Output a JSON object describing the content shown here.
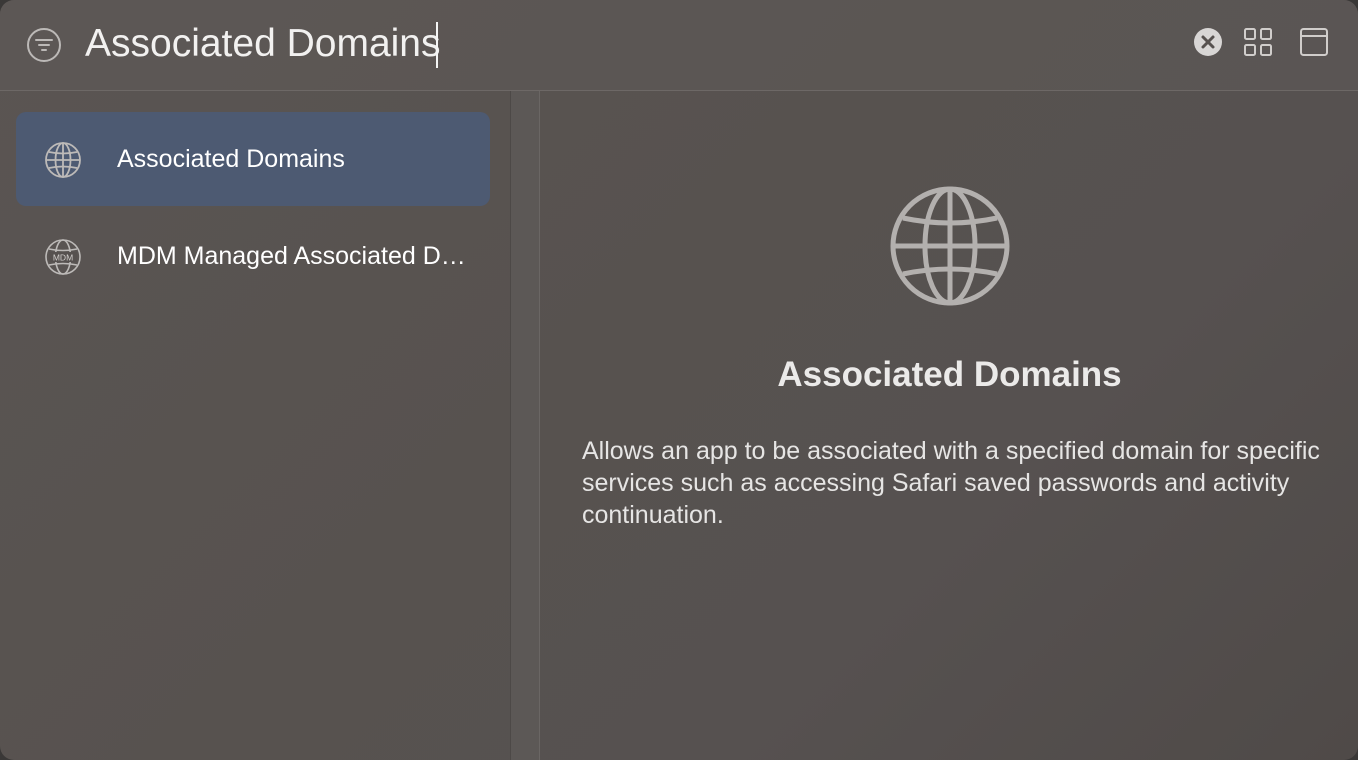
{
  "search": {
    "value": "Associated Domains",
    "filter_icon": "filter-lines-icon",
    "clear_icon": "clear-x-circle-icon",
    "grid_icon": "grid-view-icon",
    "window_icon": "window-panel-icon"
  },
  "sidebar": {
    "items": [
      {
        "label": "Associated Domains",
        "icon": "globe-icon",
        "selected": true
      },
      {
        "label": "MDM Managed Associated Domains",
        "icon": "mdm-globe-icon",
        "selected": false
      }
    ]
  },
  "detail": {
    "icon": "globe-icon",
    "title": "Associated Domains",
    "description": "Allows an app to be associated with a specified domain for specific services such as accessing Safari saved passwords and activity continuation.",
    "mdm_badge": "MDM"
  },
  "colors": {
    "selection": "#4d5a72",
    "text": "#ffffff",
    "icon": "#bdbab8"
  }
}
